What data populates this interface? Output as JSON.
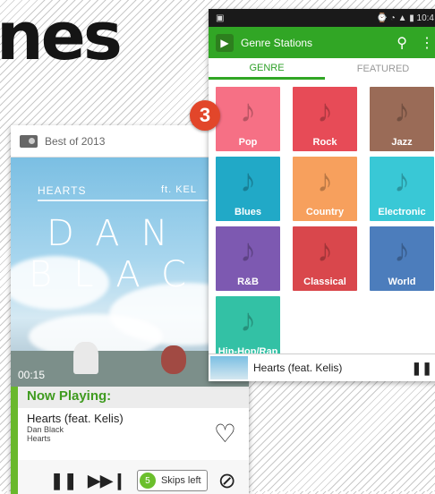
{
  "headline": "nes",
  "badge": "3",
  "left_phone": {
    "title": "Best of 2013",
    "time": "00:15",
    "art": {
      "hearts": "HEARTS",
      "ft": "ft. KEL",
      "line1": "DAN",
      "line2": "BLAC"
    },
    "now_playing_label": "Now Playing:",
    "song": {
      "title": "Hearts (feat. Kelis)",
      "artist": "Dan Black",
      "album": "Hearts"
    },
    "skips": {
      "count": "5",
      "label": "Skips left"
    }
  },
  "right_phone": {
    "status_time": "10:4",
    "app_title": "Genre Stations",
    "tabs": [
      {
        "label": "GENRE"
      },
      {
        "label": "FEATURED"
      }
    ],
    "genres": [
      {
        "label": "Pop",
        "color": "#f67085"
      },
      {
        "label": "Rock",
        "color": "#e74b57"
      },
      {
        "label": "Jazz",
        "color": "#9a6b57"
      },
      {
        "label": "Blues",
        "color": "#21a9c7"
      },
      {
        "label": "Country",
        "color": "#f7a05d"
      },
      {
        "label": "Electronic",
        "color": "#39c8d6"
      },
      {
        "label": "R&B",
        "color": "#7d59b1"
      },
      {
        "label": "Classical",
        "color": "#d9474c"
      },
      {
        "label": "World",
        "color": "#4c7dbc"
      },
      {
        "label": "Hip-Hop/Rap",
        "color": "#33c1a5"
      }
    ],
    "mini_player": {
      "song": "Hearts (feat. Kelis)"
    }
  }
}
